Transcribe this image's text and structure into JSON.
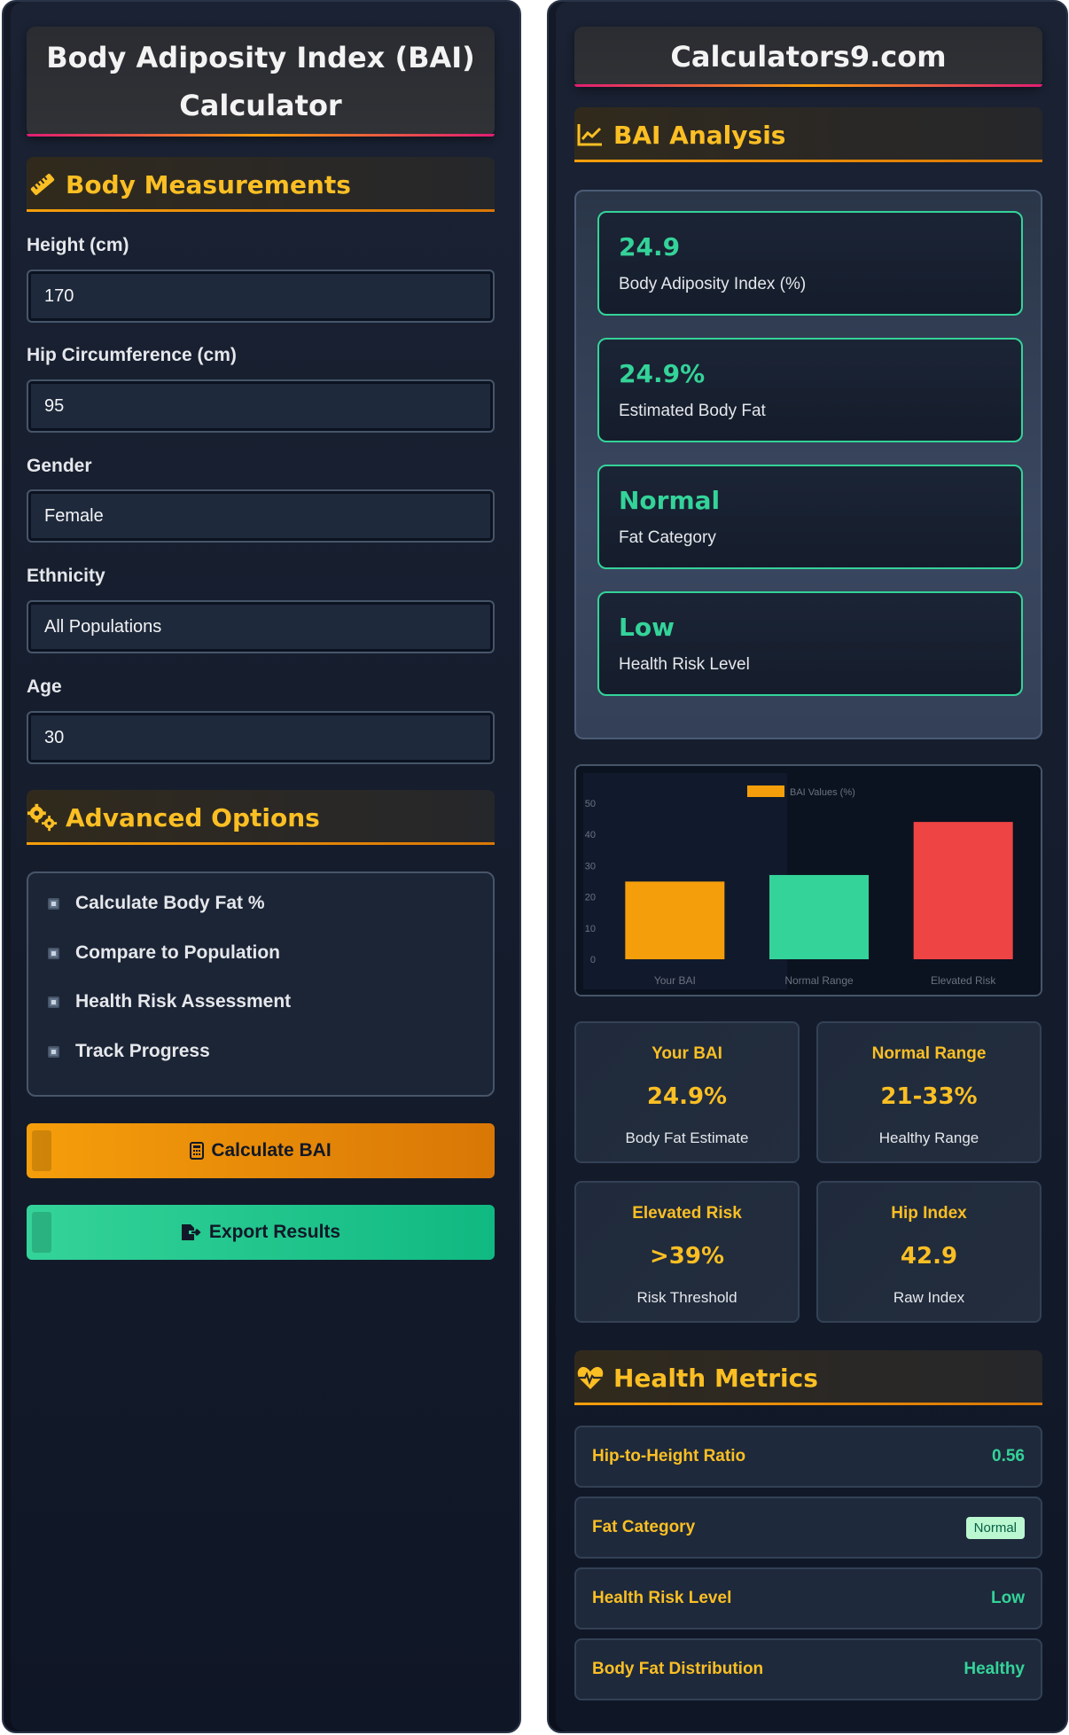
{
  "left": {
    "title_line1": "Body Adiposity Index (BAI)",
    "title_line2": "Calculator",
    "measurements_heading": "Body Measurements",
    "fields": {
      "height_label": "Height (cm)",
      "height_value": "170",
      "hip_label": "Hip Circumference (cm)",
      "hip_value": "95",
      "gender_label": "Gender",
      "gender_value": "Female",
      "ethnicity_label": "Ethnicity",
      "ethnicity_value": "All Populations",
      "age_label": "Age",
      "age_value": "30"
    },
    "advanced_heading": "Advanced Options",
    "options": [
      "Calculate Body Fat %",
      "Compare to Population",
      "Health Risk Assessment",
      "Track Progress"
    ],
    "calculate_button": "Calculate BAI",
    "export_button": "Export Results"
  },
  "right": {
    "site_title": "Calculators9.com",
    "analysis_heading": "BAI Analysis",
    "results": [
      {
        "value": "24.9",
        "label": "Body Adiposity Index (%)"
      },
      {
        "value": "24.9%",
        "label": "Estimated Body Fat"
      },
      {
        "value": "Normal",
        "label": "Fat Category"
      },
      {
        "value": "Low",
        "label": "Health Risk Level"
      }
    ],
    "stats": [
      {
        "title": "Your BAI",
        "value": "24.9%",
        "sub": "Body Fat Estimate"
      },
      {
        "title": "Normal Range",
        "value": "21-33%",
        "sub": "Healthy Range"
      },
      {
        "title": "Elevated Risk",
        "value": ">39%",
        "sub": "Risk Threshold"
      },
      {
        "title": "Hip Index",
        "value": "42.9",
        "sub": "Raw Index"
      }
    ],
    "health_heading": "Health Metrics",
    "metrics": [
      {
        "label": "Hip-to-Height Ratio",
        "value": "0.56"
      },
      {
        "label": "Fat Category",
        "value": "Normal"
      },
      {
        "label": "Health Risk Level",
        "value": "Low"
      },
      {
        "label": "Body Fat Distribution",
        "value": "Healthy"
      }
    ]
  },
  "colors": {
    "accent": "#fbbf24",
    "success": "#34d399",
    "danger": "#ef4444",
    "orange": "#f59e0b"
  },
  "icons": {
    "measurements": "ruler-icon",
    "advanced": "gears-icon",
    "analysis": "chart-line-icon",
    "health": "heartbeat-icon",
    "calculate": "calculator-icon",
    "export": "file-export-icon"
  },
  "chart_data": {
    "type": "bar",
    "legend": "BAI Values (%)",
    "legend_position": "top",
    "categories": [
      "Your BAI",
      "Normal Range",
      "Elevated Risk"
    ],
    "values": [
      24.9,
      27,
      44
    ],
    "colors": [
      "#f59e0b",
      "#34d399",
      "#ef4444"
    ],
    "ylim": [
      0,
      50
    ],
    "yticks": [
      0,
      10,
      20,
      30,
      40,
      50
    ],
    "grid": false
  }
}
